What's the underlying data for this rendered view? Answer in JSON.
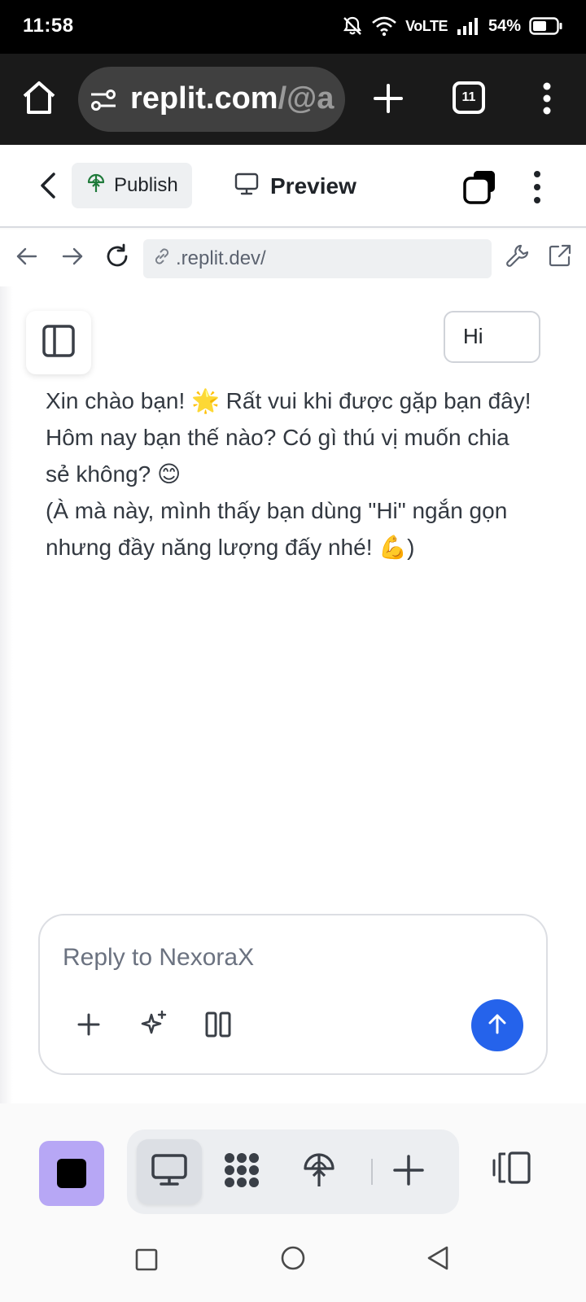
{
  "status_bar": {
    "time": "11:58",
    "network": "VoLTE",
    "battery": "54%"
  },
  "browser": {
    "url_main": "replit.com",
    "url_rest": "/@a",
    "tab_count": "11",
    "icons": [
      "home-icon",
      "tune-icon",
      "plus-icon",
      "tabs-icon",
      "more-vertical-icon"
    ]
  },
  "app_header": {
    "publish_label": "Publish",
    "preview_label": "Preview"
  },
  "preview_bar": {
    "url": ".replit.dev/"
  },
  "chat": {
    "user_message": "Hi",
    "assistant_message": "Xin chào bạn! 🌟 Rất vui khi được gặp bạn đây! Hôm nay bạn thế nào? Có gì thú vị muốn chia sẻ không? 😊\n(À mà này, mình thấy bạn dùng \"Hi\" ngắn gọn nhưng đầy năng lượng đấy nhé! 💪)",
    "reply_placeholder": "Reply to NexoraX"
  },
  "colors": {
    "accent": "#2563eb",
    "stop_button": "#b7a7f5",
    "browser_bg": "#1a1a1a"
  }
}
